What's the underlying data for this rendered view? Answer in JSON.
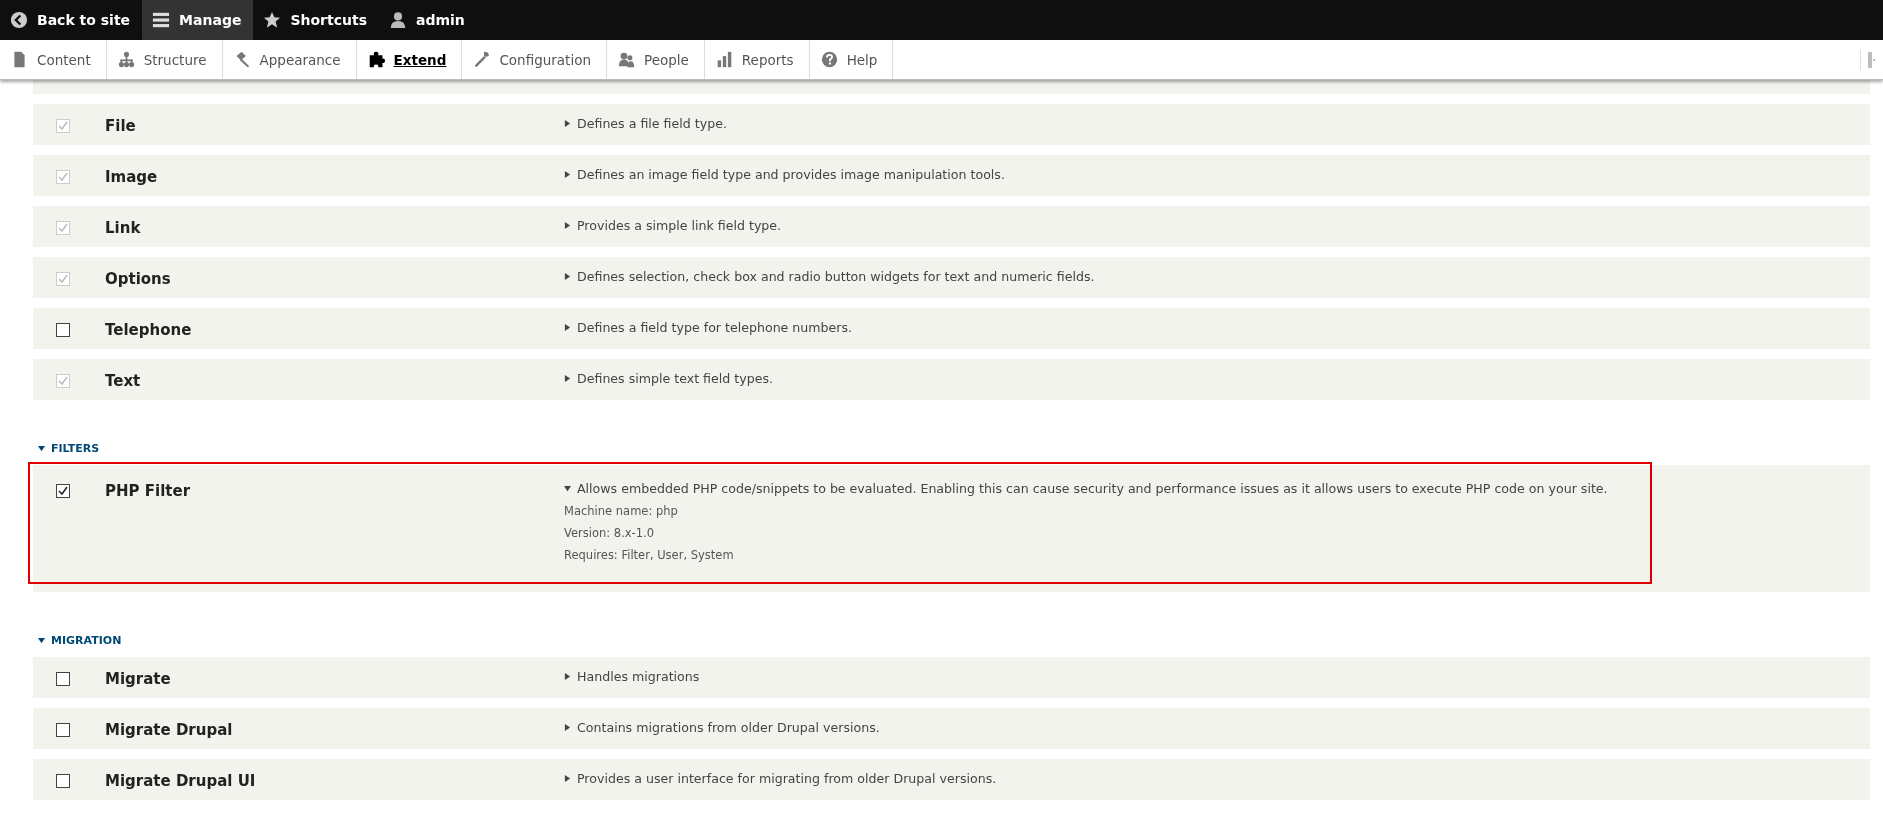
{
  "toolbar": {
    "items": [
      {
        "label": "Back to site",
        "selected": false
      },
      {
        "label": "Manage",
        "selected": true
      },
      {
        "label": "Shortcuts",
        "selected": false
      },
      {
        "label": "admin",
        "selected": false
      }
    ]
  },
  "tray": {
    "items": [
      {
        "label": "Content",
        "selected": false
      },
      {
        "label": "Structure",
        "selected": false
      },
      {
        "label": "Appearance",
        "selected": false
      },
      {
        "label": "Extend",
        "selected": true
      },
      {
        "label": "Configuration",
        "selected": false
      },
      {
        "label": "People",
        "selected": false
      },
      {
        "label": "Reports",
        "selected": false
      },
      {
        "label": "Help",
        "selected": false
      }
    ]
  },
  "sections": [
    {
      "modules": [
        {
          "name": "File",
          "description": "Defines a file field type.",
          "checked": true,
          "disabled": true,
          "expanded": false,
          "highlighted": false
        },
        {
          "name": "Image",
          "description": "Defines an image field type and provides image manipulation tools.",
          "checked": true,
          "disabled": true,
          "expanded": false,
          "highlighted": false
        },
        {
          "name": "Link",
          "description": "Provides a simple link field type.",
          "checked": true,
          "disabled": true,
          "expanded": false,
          "highlighted": false
        },
        {
          "name": "Options",
          "description": "Defines selection, check box and radio button widgets for text and numeric fields.",
          "checked": true,
          "disabled": true,
          "expanded": false,
          "highlighted": false
        },
        {
          "name": "Telephone",
          "description": "Defines a field type for telephone numbers.",
          "checked": false,
          "disabled": false,
          "expanded": false,
          "highlighted": false
        },
        {
          "name": "Text",
          "description": "Defines simple text field types.",
          "checked": true,
          "disabled": true,
          "expanded": false,
          "highlighted": false
        }
      ]
    },
    {
      "title": "FILTERS",
      "modules": [
        {
          "name": "PHP Filter",
          "description": "Allows embedded PHP code/snippets to be evaluated. Enabling this can cause security and performance issues as it allows users to execute PHP code on your site.",
          "checked": true,
          "disabled": false,
          "expanded": true,
          "highlighted": true,
          "details": [
            "Machine name: php",
            "Version: 8.x-1.0",
            "Requires: Filter, User, System"
          ]
        }
      ]
    },
    {
      "title": "MIGRATION",
      "modules": [
        {
          "name": "Migrate",
          "description": "Handles migrations",
          "checked": false,
          "disabled": false,
          "expanded": false,
          "highlighted": false
        },
        {
          "name": "Migrate Drupal",
          "description": "Contains migrations from older Drupal versions.",
          "checked": false,
          "disabled": false,
          "expanded": false,
          "highlighted": false
        },
        {
          "name": "Migrate Drupal UI",
          "description": "Provides a user interface for migrating from older Drupal versions.",
          "checked": false,
          "disabled": false,
          "expanded": false,
          "highlighted": false
        }
      ]
    }
  ]
}
